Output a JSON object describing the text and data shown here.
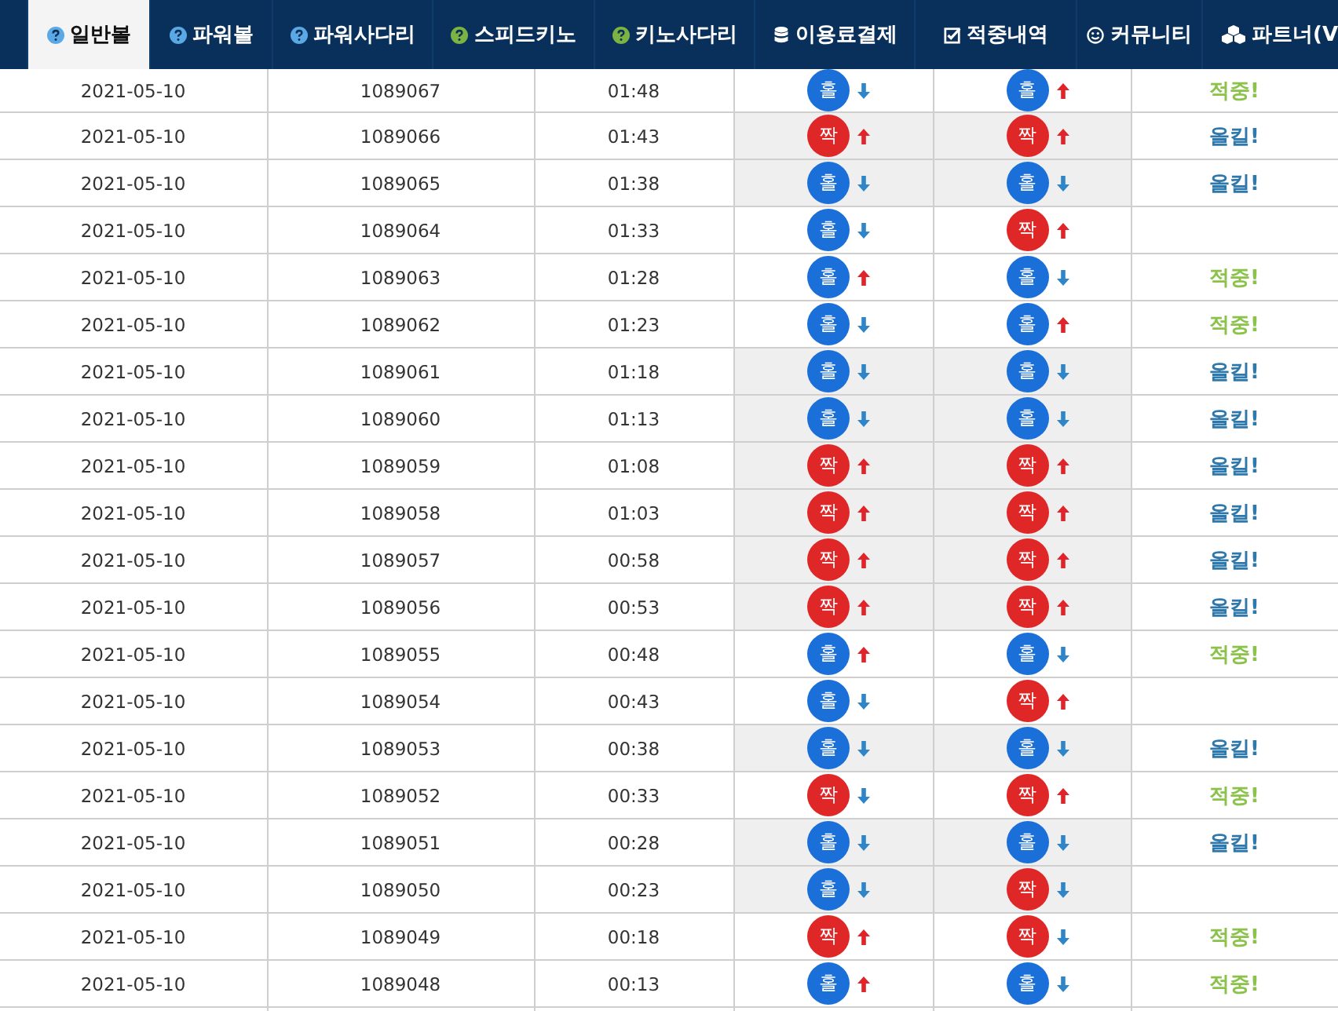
{
  "nav_tabs": [
    {
      "label": "일반볼",
      "selected": true
    },
    {
      "label": "파워볼",
      "selected": false
    },
    {
      "label": "파워사다리",
      "selected": false
    },
    {
      "label": "스피드키노",
      "selected": false
    },
    {
      "label": "키노사다리",
      "selected": false
    },
    {
      "label": "이용료결제",
      "selected": false
    },
    {
      "label": "적중내역",
      "selected": false
    },
    {
      "label": "커뮤니티",
      "selected": false
    },
    {
      "label": "파트너(V",
      "selected": false
    }
  ],
  "rows": [
    {
      "date": "2021-05-10",
      "round": "1089067",
      "time": "01:48",
      "shaded": false,
      "picks": [
        {
          "label": "홀",
          "color": "#1a6fd8",
          "up": false
        },
        {
          "label": "홀",
          "color": "#1a6fd8",
          "up": true
        }
      ],
      "result": {
        "kind": "hit",
        "text": "적중!"
      }
    },
    {
      "date": "2021-05-10",
      "round": "1089066",
      "time": "01:43",
      "shaded": true,
      "picks": [
        {
          "label": "짝",
          "color": "#e02727",
          "up": true
        },
        {
          "label": "짝",
          "color": "#e02727",
          "up": true
        }
      ],
      "result": {
        "kind": "allkill",
        "text": "올킬!"
      }
    },
    {
      "date": "2021-05-10",
      "round": "1089065",
      "time": "01:38",
      "shaded": true,
      "picks": [
        {
          "label": "홀",
          "color": "#1a6fd8",
          "up": false
        },
        {
          "label": "홀",
          "color": "#1a6fd8",
          "up": false
        }
      ],
      "result": {
        "kind": "allkill",
        "text": "올킬!"
      }
    },
    {
      "date": "2021-05-10",
      "round": "1089064",
      "time": "01:33",
      "shaded": false,
      "picks": [
        {
          "label": "홀",
          "color": "#1a6fd8",
          "up": false
        },
        {
          "label": "짝",
          "color": "#e02727",
          "up": true
        }
      ]
    },
    {
      "date": "2021-05-10",
      "round": "1089063",
      "time": "01:28",
      "shaded": false,
      "picks": [
        {
          "label": "홀",
          "color": "#1a6fd8",
          "up": true
        },
        {
          "label": "홀",
          "color": "#1a6fd8",
          "up": false
        }
      ],
      "result": {
        "kind": "hit",
        "text": "적중!"
      }
    },
    {
      "date": "2021-05-10",
      "round": "1089062",
      "time": "01:23",
      "shaded": false,
      "picks": [
        {
          "label": "홀",
          "color": "#1a6fd8",
          "up": false
        },
        {
          "label": "홀",
          "color": "#1a6fd8",
          "up": true
        }
      ],
      "result": {
        "kind": "hit",
        "text": "적중!"
      }
    },
    {
      "date": "2021-05-10",
      "round": "1089061",
      "time": "01:18",
      "shaded": true,
      "picks": [
        {
          "label": "홀",
          "color": "#1a6fd8",
          "up": false
        },
        {
          "label": "홀",
          "color": "#1a6fd8",
          "up": false
        }
      ],
      "result": {
        "kind": "allkill",
        "text": "올킬!"
      }
    },
    {
      "date": "2021-05-10",
      "round": "1089060",
      "time": "01:13",
      "shaded": true,
      "picks": [
        {
          "label": "홀",
          "color": "#1a6fd8",
          "up": false
        },
        {
          "label": "홀",
          "color": "#1a6fd8",
          "up": false
        }
      ],
      "result": {
        "kind": "allkill",
        "text": "올킬!"
      }
    },
    {
      "date": "2021-05-10",
      "round": "1089059",
      "time": "01:08",
      "shaded": true,
      "picks": [
        {
          "label": "짝",
          "color": "#e02727",
          "up": true
        },
        {
          "label": "짝",
          "color": "#e02727",
          "up": true
        }
      ],
      "result": {
        "kind": "allkill",
        "text": "올킬!"
      }
    },
    {
      "date": "2021-05-10",
      "round": "1089058",
      "time": "01:03",
      "shaded": true,
      "picks": [
        {
          "label": "짝",
          "color": "#e02727",
          "up": true
        },
        {
          "label": "짝",
          "color": "#e02727",
          "up": true
        }
      ],
      "result": {
        "kind": "allkill",
        "text": "올킬!"
      }
    },
    {
      "date": "2021-05-10",
      "round": "1089057",
      "time": "00:58",
      "shaded": true,
      "picks": [
        {
          "label": "짝",
          "color": "#e02727",
          "up": true
        },
        {
          "label": "짝",
          "color": "#e02727",
          "up": true
        }
      ],
      "result": {
        "kind": "allkill",
        "text": "올킬!"
      }
    },
    {
      "date": "2021-05-10",
      "round": "1089056",
      "time": "00:53",
      "shaded": true,
      "picks": [
        {
          "label": "짝",
          "color": "#e02727",
          "up": true
        },
        {
          "label": "짝",
          "color": "#e02727",
          "up": true
        }
      ],
      "result": {
        "kind": "allkill",
        "text": "올킬!"
      }
    },
    {
      "date": "2021-05-10",
      "round": "1089055",
      "time": "00:48",
      "shaded": false,
      "picks": [
        {
          "label": "홀",
          "color": "#1a6fd8",
          "up": true
        },
        {
          "label": "홀",
          "color": "#1a6fd8",
          "up": false
        }
      ],
      "result": {
        "kind": "hit",
        "text": "적중!"
      }
    },
    {
      "date": "2021-05-10",
      "round": "1089054",
      "time": "00:43",
      "shaded": false,
      "picks": [
        {
          "label": "홀",
          "color": "#1a6fd8",
          "up": false
        },
        {
          "label": "짝",
          "color": "#e02727",
          "up": true
        }
      ]
    },
    {
      "date": "2021-05-10",
      "round": "1089053",
      "time": "00:38",
      "shaded": true,
      "picks": [
        {
          "label": "홀",
          "color": "#1a6fd8",
          "up": false
        },
        {
          "label": "홀",
          "color": "#1a6fd8",
          "up": false
        }
      ],
      "result": {
        "kind": "allkill",
        "text": "올킬!"
      }
    },
    {
      "date": "2021-05-10",
      "round": "1089052",
      "time": "00:33",
      "shaded": false,
      "picks": [
        {
          "label": "짝",
          "color": "#e02727",
          "up": false
        },
        {
          "label": "짝",
          "color": "#e02727",
          "up": true
        }
      ],
      "result": {
        "kind": "hit",
        "text": "적중!"
      }
    },
    {
      "date": "2021-05-10",
      "round": "1089051",
      "time": "00:28",
      "shaded": true,
      "picks": [
        {
          "label": "홀",
          "color": "#1a6fd8",
          "up": false
        },
        {
          "label": "홀",
          "color": "#1a6fd8",
          "up": false
        }
      ],
      "result": {
        "kind": "allkill",
        "text": "올킬!"
      }
    },
    {
      "date": "2021-05-10",
      "round": "1089050",
      "time": "00:23",
      "shaded": true,
      "picks": [
        {
          "label": "홀",
          "color": "#1a6fd8",
          "up": false
        },
        {
          "label": "짝",
          "color": "#e02727",
          "up": false
        }
      ]
    },
    {
      "date": "2021-05-10",
      "round": "1089049",
      "time": "00:18",
      "shaded": false,
      "picks": [
        {
          "label": "짝",
          "color": "#e02727",
          "up": true
        },
        {
          "label": "짝",
          "color": "#e02727",
          "up": false
        }
      ],
      "result": {
        "kind": "hit",
        "text": "적중!"
      }
    },
    {
      "date": "2021-05-10",
      "round": "1089048",
      "time": "00:13",
      "shaded": false,
      "picks": [
        {
          "label": "홀",
          "color": "#1a6fd8",
          "up": true
        },
        {
          "label": "홀",
          "color": "#1a6fd8",
          "up": false
        }
      ],
      "result": {
        "kind": "hit",
        "text": "적중!"
      }
    }
  ]
}
